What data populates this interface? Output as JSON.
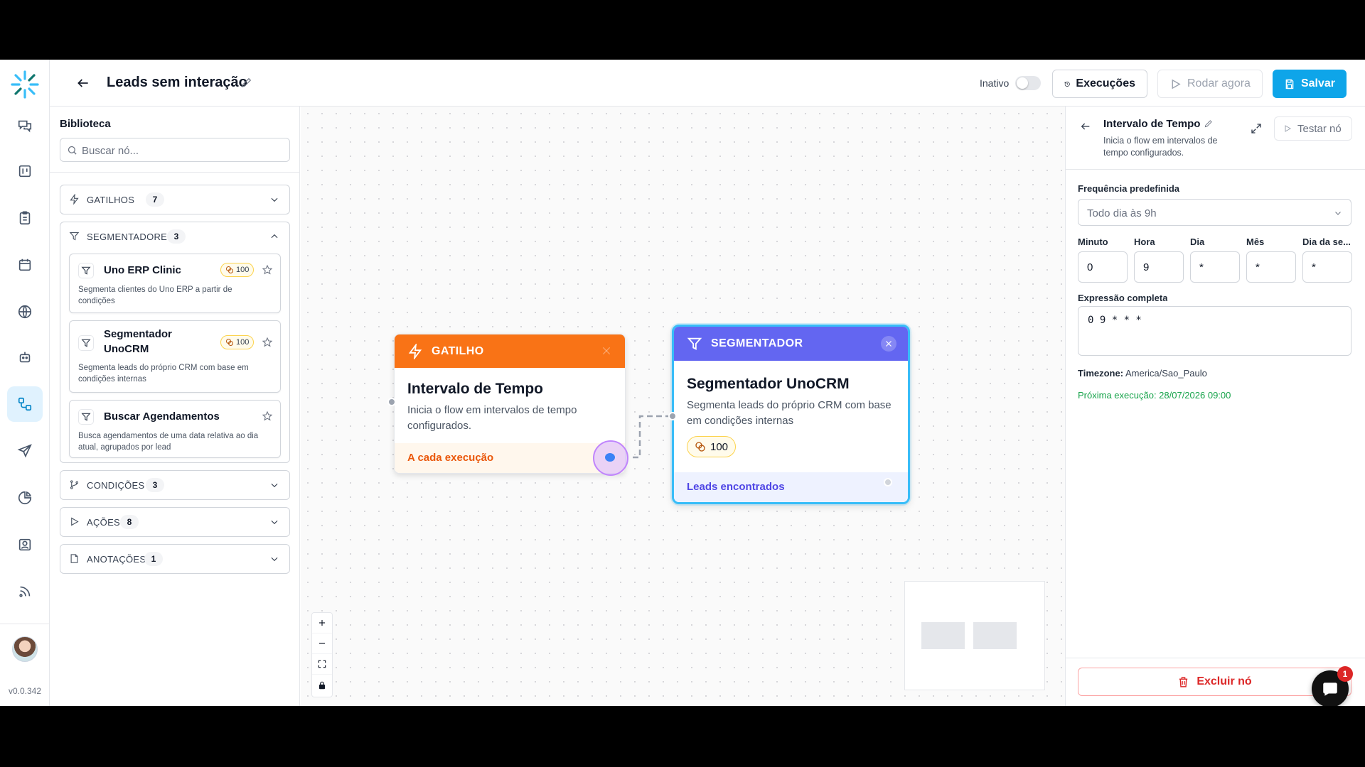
{
  "app": {
    "version": "v0.0.342"
  },
  "rail": {
    "items": [
      "conversations-icon",
      "kanban-icon",
      "clipboard-icon",
      "calendar-icon",
      "globe-icon",
      "bot-icon",
      "workflow-icon",
      "send-icon",
      "pie-chart-icon",
      "contacts-icon",
      "rss-icon"
    ],
    "active": "workflow-icon"
  },
  "header": {
    "title": "Leads sem interação",
    "status_label": "Inativo",
    "executions_label": "Execuções",
    "run_now_label": "Rodar agora",
    "save_label": "Salvar"
  },
  "library": {
    "title": "Biblioteca",
    "search_placeholder": "Buscar nó...",
    "categories": [
      {
        "label": "GATILHOS",
        "count": "7",
        "expanded": false
      },
      {
        "label": "SEGMENTADORES",
        "count": "3",
        "expanded": true
      },
      {
        "label": "CONDIÇÕES",
        "count": "3",
        "expanded": false
      },
      {
        "label": "AÇÕES",
        "count": "8",
        "expanded": false
      },
      {
        "label": "ANOTAÇÕES",
        "count": "1",
        "expanded": false
      }
    ],
    "segmenters": [
      {
        "name": "Uno ERP Clinic",
        "credits": "100",
        "description": "Segmenta clientes do Uno ERP a partir de condições"
      },
      {
        "name": "Segmentador UnoCRM",
        "credits": "100",
        "description": "Segmenta leads do próprio CRM com base em condições internas"
      },
      {
        "name": "Buscar Agendamentos",
        "description": "Busca agendamentos de uma data relativa ao dia atual, agrupados por lead"
      }
    ]
  },
  "canvas": {
    "trigger_node": {
      "header": "GATILHO",
      "title": "Intervalo de Tempo",
      "description": "Inicia o flow em intervalos de tempo configurados.",
      "footer": "A cada execução"
    },
    "segment_node": {
      "header": "SEGMENTADOR",
      "title": "Segmentador UnoCRM",
      "description": "Segmenta leads do próprio CRM com base em condições internas",
      "credits": "100",
      "footer": "Leads encontrados"
    }
  },
  "panel": {
    "title": "Intervalo de Tempo",
    "description": "Inicia o flow em intervalos de tempo configurados.",
    "test_label": "Testar nó",
    "freq_label": "Frequência predefinida",
    "freq_value": "Todo dia às 9h",
    "cron_fields": [
      {
        "label": "Minuto",
        "value": "0"
      },
      {
        "label": "Hora",
        "value": "9"
      },
      {
        "label": "Dia",
        "value": "*"
      },
      {
        "label": "Mês",
        "value": "*"
      },
      {
        "label": "Dia da se...",
        "value": "*"
      }
    ],
    "expression_label": "Expressão completa",
    "expression_value": "0 9 * * *",
    "timezone_label": "Timezone:",
    "timezone_value": "America/Sao_Paulo",
    "next_run": "Próxima execução: 28/07/2026 09:00",
    "delete_label": "Excluir nó"
  },
  "chat": {
    "badge": "1"
  },
  "colors": {
    "accent": "#0ea5e9",
    "trigger": "#f97316",
    "segmenter": "#6366f1",
    "danger": "#dc2626"
  }
}
